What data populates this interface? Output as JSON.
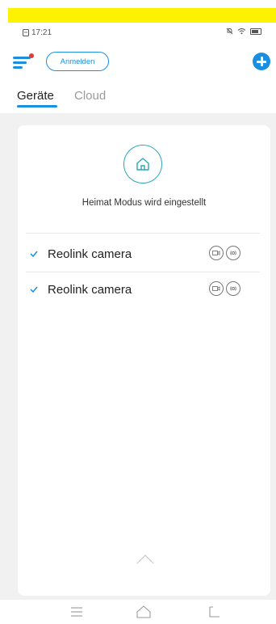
{
  "status_bar": {
    "time": "17:21",
    "icons": [
      "photo-notification-icon",
      "mute-icon",
      "wifi-icon",
      "battery-icon"
    ]
  },
  "header": {
    "login_label": "Anmelden",
    "icons": [
      "menu-icon",
      "add-icon"
    ]
  },
  "tabs": [
    {
      "label": "Geräte",
      "active": true
    },
    {
      "label": "Cloud",
      "active": false
    }
  ],
  "mode": {
    "icon": "home-icon",
    "text": "Heimat Modus wird eingestellt"
  },
  "devices": [
    {
      "name": "Reolink camera",
      "checked": true,
      "icons": [
        "camera-status-icon",
        "motion-status-icon"
      ]
    },
    {
      "name": "Reolink camera",
      "checked": true,
      "icons": [
        "camera-status-icon",
        "motion-status-icon"
      ]
    }
  ],
  "nav_bar": {
    "icons": [
      "menu-nav-icon",
      "home-nav-icon",
      "back-nav-icon"
    ]
  },
  "colors": {
    "accent": "#1a8fe0",
    "teal": "#2aa7b8",
    "notification": "#e23b3b",
    "highlight": "#fff200"
  }
}
